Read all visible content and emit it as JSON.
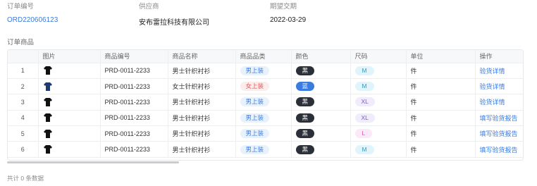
{
  "order_info": {
    "order_no_label": "订单编号",
    "order_no_value": "ORD220606123",
    "supplier_label": "供应商",
    "supplier_value": "安布雷拉科技有限公司",
    "delivery_label": "期望交期",
    "delivery_value": "2022-03-29"
  },
  "section_title": "订单商品",
  "table": {
    "headers": [
      "",
      "图片",
      "商品编号",
      "商品名称",
      "商品品类",
      "颜色",
      "尺码",
      "单位",
      "操作"
    ],
    "rows": [
      {
        "index": "1",
        "image": "black-shirt-icon",
        "code": "PRD-0011-2233",
        "name": "男士针织衬衫",
        "category": "男上装",
        "category_tone": "blue",
        "color": "黑",
        "color_tone": "dark",
        "size": "M",
        "size_tone": "cyan",
        "unit": "件",
        "action": "验货详情"
      },
      {
        "index": "2",
        "image": "navy-shirt-icon",
        "code": "PRD-0011-2233",
        "name": "女士针织衬衫",
        "category": "女上装",
        "category_tone": "red",
        "color": "蓝",
        "color_tone": "blue",
        "size": "M",
        "size_tone": "cyan",
        "unit": "件",
        "action": "验货详情"
      },
      {
        "index": "3",
        "image": "black-shirt-icon",
        "code": "PRD-0011-2233",
        "name": "男士针织衬衫",
        "category": "男上装",
        "category_tone": "blue",
        "color": "黑",
        "color_tone": "dark",
        "size": "XL",
        "size_tone": "purple",
        "unit": "件",
        "action": "验货详情"
      },
      {
        "index": "4",
        "image": "black-shirt-icon",
        "code": "PRD-0011-2233",
        "name": "男士针织衬衫",
        "category": "男上装",
        "category_tone": "blue",
        "color": "黑",
        "color_tone": "dark",
        "size": "XL",
        "size_tone": "purple",
        "unit": "件",
        "action": "填写验货报告"
      },
      {
        "index": "5",
        "image": "black-shirt-icon",
        "code": "PRD-0011-2233",
        "name": "男士针织衬衫",
        "category": "男上装",
        "category_tone": "blue",
        "color": "黑",
        "color_tone": "dark",
        "size": "L",
        "size_tone": "pink",
        "unit": "件",
        "action": "填写验货报告"
      },
      {
        "index": "6",
        "image": "black-shirt-icon",
        "code": "PRD-0011-2233",
        "name": "男士针织衬衫",
        "category": "男上装",
        "category_tone": "blue",
        "color": "黑",
        "color_tone": "dark",
        "size": "M",
        "size_tone": "cyan",
        "unit": "件",
        "action": "填写验货报告"
      }
    ]
  },
  "footer": "共计 0 条数据",
  "colors": {
    "accent": "#3a7be0",
    "tag_blue_bg": "#e8f2fd",
    "tag_red_bg": "#fdecec",
    "tag_dark": "#2b2f38"
  }
}
